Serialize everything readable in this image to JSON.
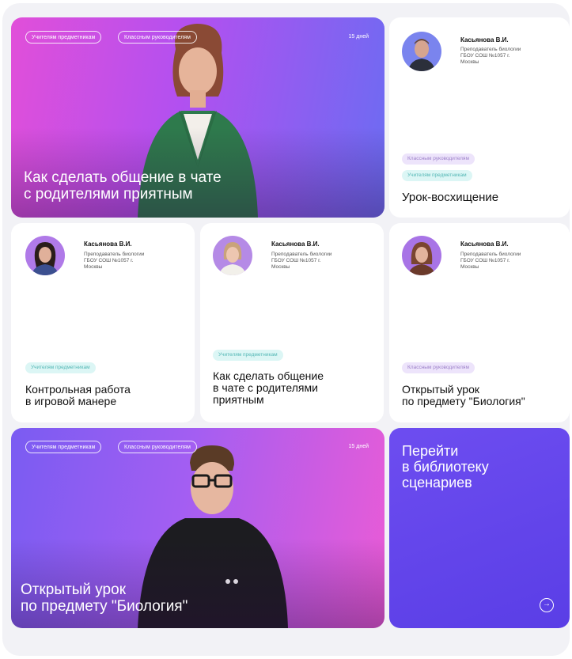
{
  "hero_top": {
    "tags": [
      "Учителям предметникам",
      "Классным руководителям"
    ],
    "duration": "15 дней",
    "title_line1": "Как сделать общение в чате",
    "title_line2": "с родителями приятным"
  },
  "card_top_right": {
    "author": "Касьянова В.И.",
    "desc_line1": "Преподаватель биологии",
    "desc_line2": "ГБОУ СОШ №1057 г.",
    "desc_line3": "Москвы",
    "tags": [
      "Классным руководителям",
      "Учителям предметникам"
    ],
    "title": "Урок-восхищение"
  },
  "card_row2_1": {
    "author": "Касьянова В.И.",
    "desc_line1": "Преподаватель биологии",
    "desc_line2": "ГБОУ СОШ №1057 г.",
    "desc_line3": "Москвы",
    "tags": [
      "Учителям предметникам"
    ],
    "title_line1": "Контрольная работа",
    "title_line2": "в игровой манере"
  },
  "card_row2_2": {
    "author": "Касьянова В.И.",
    "desc_line1": "Преподаватель биологии",
    "desc_line2": "ГБОУ СОШ №1057 г.",
    "desc_line3": "Москвы",
    "tags": [
      "Учителям предметникам"
    ],
    "title_line1": "Как сделать общение",
    "title_line2": "в чате с родителями",
    "title_line3": "приятным"
  },
  "card_row2_3": {
    "author": "Касьянова В.И.",
    "desc_line1": "Преподаватель биологии",
    "desc_line2": "ГБОУ СОШ №1057 г.",
    "desc_line3": "Москвы",
    "tags": [
      "Классным руководителям"
    ],
    "title_line1": "Открытый урок",
    "title_line2": "по предмету \"Биология\""
  },
  "hero_bottom": {
    "tags": [
      "Учителям предметникам",
      "Классным руководителям"
    ],
    "duration": "15 дней",
    "title_line1": "Открытый урок",
    "title_line2": "по предмету \"Биология\""
  },
  "cta": {
    "line1": "Перейти",
    "line2": "в библиотеку",
    "line3": "сценариев",
    "icon": "arrow-right-circle-icon"
  },
  "colors": {
    "cta": "#5c40e8",
    "pill_purple_bg": "#ede4fb",
    "pill_mint_bg": "#dcf6f5"
  }
}
